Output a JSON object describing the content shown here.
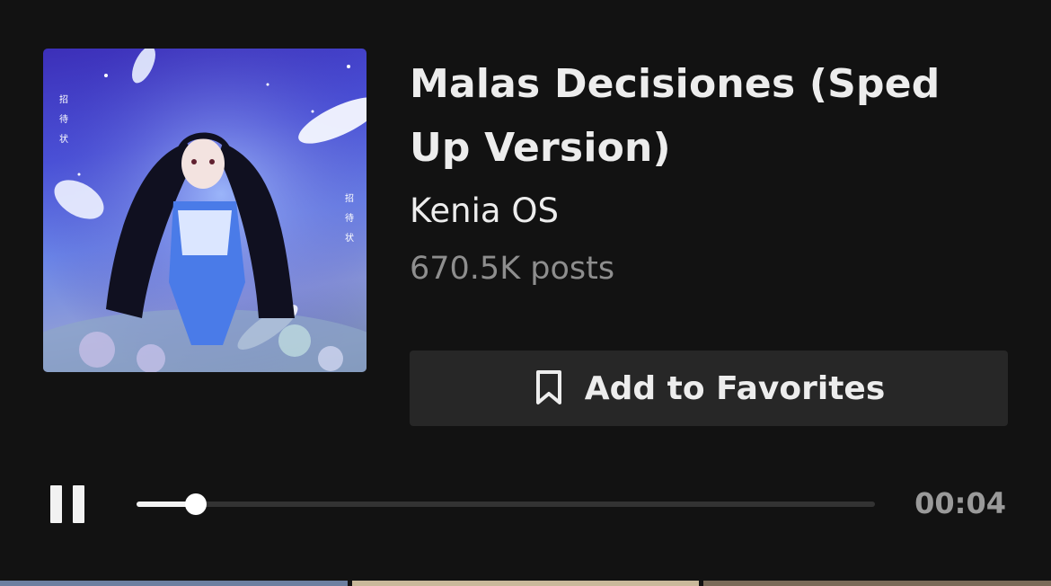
{
  "song": {
    "title": "Malas Decisiones (Sped Up Version)",
    "artist": "Kenia OS",
    "posts": "670.5K posts"
  },
  "actions": {
    "favorite_label": "Add to Favorites",
    "favorite_icon": "bookmark-icon"
  },
  "player": {
    "state": "playing",
    "control_icon": "pause-icon",
    "progress_fraction": 0.08,
    "time": "00:04"
  },
  "colors": {
    "background": "#121212",
    "button_bg": "#272727",
    "muted_text": "#8e8e8e"
  }
}
